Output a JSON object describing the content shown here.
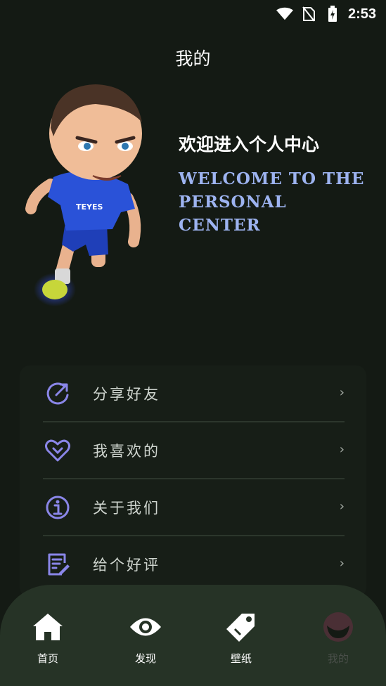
{
  "status_bar": {
    "time": "2:53"
  },
  "header": {
    "title": "我的"
  },
  "welcome": {
    "title_cn": "欢迎进入个人中心",
    "title_en": "Welcome to the personal center"
  },
  "menu": {
    "items": [
      {
        "label": "分享好友",
        "icon": "share-icon"
      },
      {
        "label": "我喜欢的",
        "icon": "heart-icon"
      },
      {
        "label": "关于我们",
        "icon": "info-icon"
      },
      {
        "label": "给个好评",
        "icon": "review-icon"
      }
    ],
    "chevron": "›",
    "accent_color": "#8a86e8"
  },
  "bottom_nav": {
    "items": [
      {
        "label": "首页",
        "icon": "home-icon"
      },
      {
        "label": "发现",
        "icon": "eye-icon"
      },
      {
        "label": "壁纸",
        "icon": "tag-icon"
      },
      {
        "label": "我的",
        "icon": "profile-icon",
        "active": true
      }
    ]
  }
}
